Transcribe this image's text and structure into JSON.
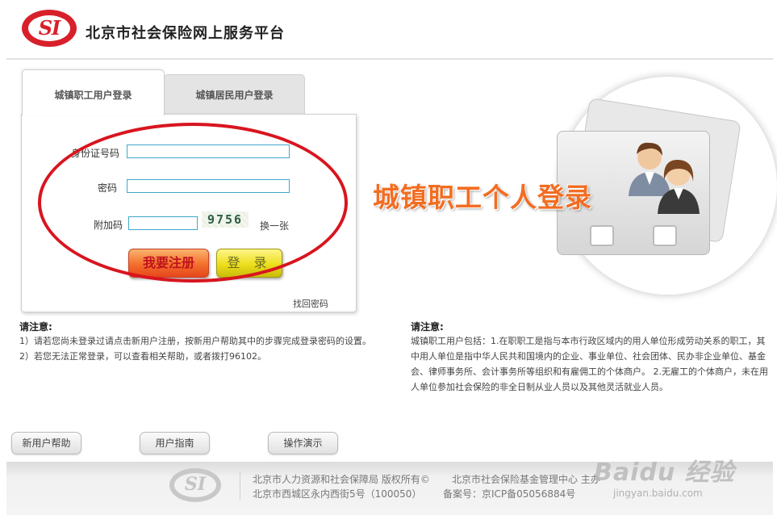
{
  "header": {
    "logo_text": "SI",
    "site_title": "北京市社会保险网上服务平台"
  },
  "login": {
    "tabs": [
      {
        "label": "城镇职工用户登录",
        "active": true
      },
      {
        "label": "城镇居民用户登录",
        "active": false
      }
    ],
    "id_label": "身份证号码",
    "id_value": "",
    "password_label": "密码",
    "password_value": "",
    "captcha_label": "附加码",
    "captcha_value": "",
    "captcha_code": "9756",
    "refresh_captcha": "换一张",
    "register_button": "我要注册",
    "login_button": "登 录",
    "forgot_password": "找回密码"
  },
  "illustration": {
    "caption": "城镇职工个人登录"
  },
  "notes_left": {
    "title": "请注意:",
    "items": [
      "1）请若您尚未登录过请点击新用户注册，按新用户帮助其中的步骤完成登录密码的设置。",
      "2）若您无法正常登录，可以查看相关帮助，或者拨打96102。"
    ]
  },
  "notes_right": {
    "title": "请注意:",
    "text": "城镇职工用户包括：1.在职职工是指与本市行政区域内的用人单位形成劳动关系的职工，其中用人单位是指中华人民共和国境内的企业、事业单位、社会团体、民办非企业单位、基金会、律师事务所、会计事务所等组织和有雇佣工的个体商户。 2.无雇工的个体商户，未在用人单位参加社会保险的非全日制从业人员以及其他灵活就业人员。"
  },
  "bottom_buttons": {
    "new_user_help": "新用户帮助",
    "user_guide": "用户指南",
    "demo": "操作演示"
  },
  "footer": {
    "copyright": "北京市人力资源和社会保障局 版权所有©",
    "organizer": "北京市社会保险基金管理中心  主办",
    "address": "北京市西城区永内西街5号（100050）",
    "icp": "备案号：京ICP备05056884号"
  },
  "watermark": {
    "brand": "Baidu 经验",
    "url": "jingyan.baidu.com"
  },
  "colors": {
    "brand_red": "#d8202a",
    "caption_orange": "#f26d22",
    "input_border": "#3fa9c8"
  }
}
